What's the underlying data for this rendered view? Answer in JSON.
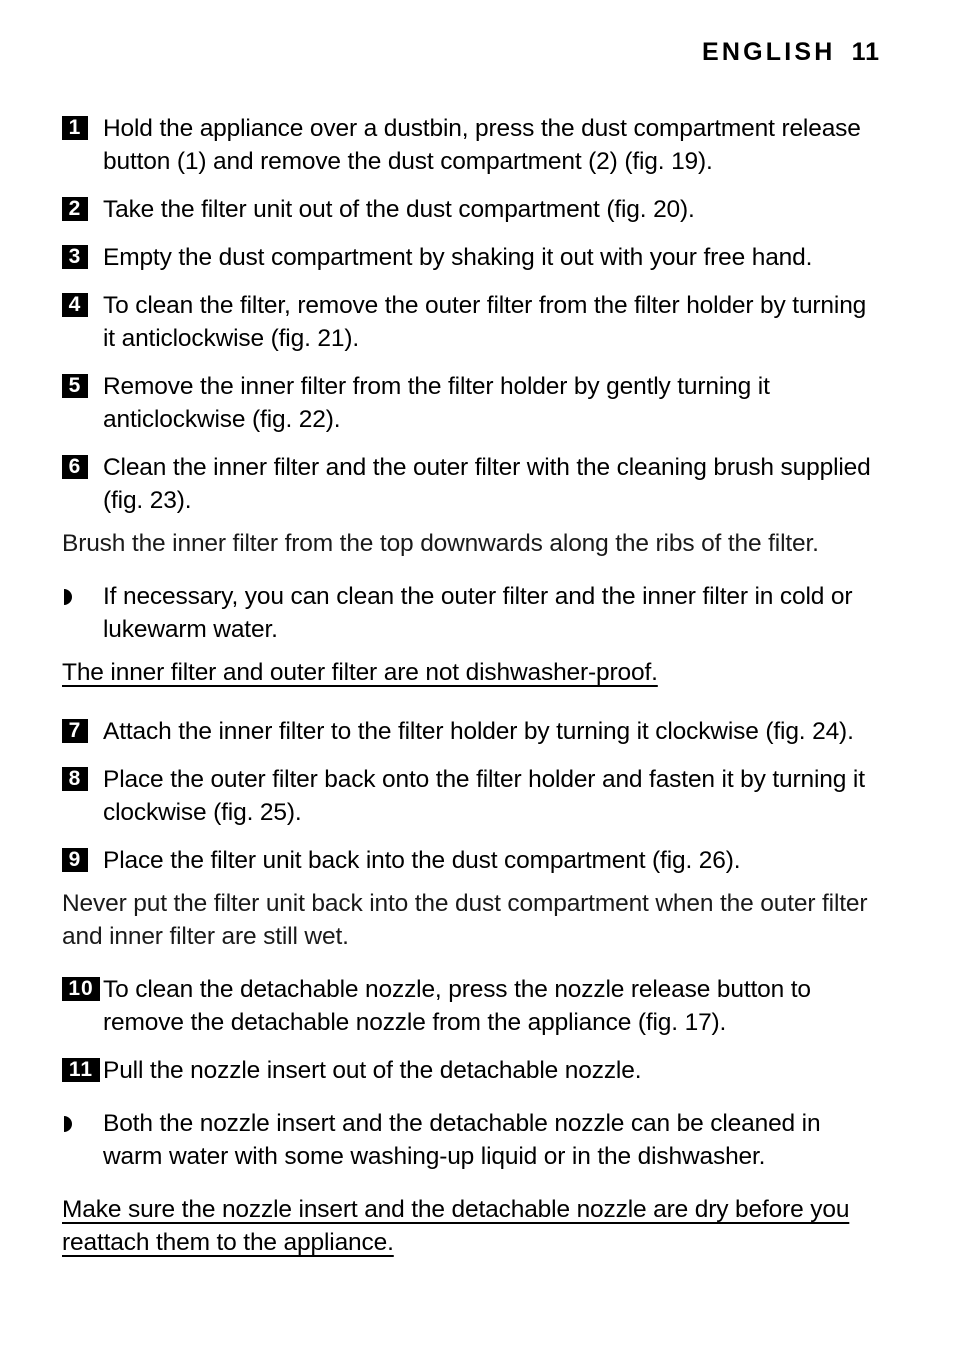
{
  "header": {
    "title": "ENGLISH",
    "page_number": "11"
  },
  "body": {
    "blocks": [
      {
        "kind": "step",
        "number": "1",
        "text": "Hold the appliance over a dustbin, press the dust compartment release button (1) and remove the dust compartment (2) (fig. 19)."
      },
      {
        "kind": "step",
        "number": "2",
        "text": "Take the filter unit out of the dust compartment (fig. 20)."
      },
      {
        "kind": "step",
        "number": "3",
        "text": "Empty the dust compartment by shaking it out with your free hand."
      },
      {
        "kind": "step",
        "number": "4",
        "text": "To clean the filter, remove the outer filter from the filter holder by turning it anticlockwise (fig. 21)."
      },
      {
        "kind": "step",
        "number": "5",
        "text": "Remove the inner filter from the filter holder by gently turning it anticlockwise (fig. 22)."
      },
      {
        "kind": "step",
        "number": "6",
        "text": "Clean the inner filter and the outer filter with the cleaning brush supplied (fig. 23)."
      },
      {
        "kind": "paragraph",
        "style": "light",
        "text": "Brush the inner filter from the top downwards along the ribs of the filter."
      },
      {
        "kind": "bullet",
        "text": "If necessary, you can clean the outer filter and the inner filter in cold or lukewarm water."
      },
      {
        "kind": "paragraph",
        "style": "underlined",
        "text": "The inner filter and outer filter are not dishwasher-proof."
      },
      {
        "kind": "step",
        "number": "7",
        "text": "Attach the inner filter to the filter holder by turning it clockwise (fig. 24)."
      },
      {
        "kind": "step",
        "number": "8",
        "text": "Place the outer filter back onto the filter holder and fasten it by turning it clockwise (fig. 25)."
      },
      {
        "kind": "step",
        "number": "9",
        "text": "Place the filter unit back into the dust compartment (fig. 26)."
      },
      {
        "kind": "paragraph",
        "style": "light",
        "text": "Never put the filter unit back into the dust compartment when the outer filter and inner filter are still wet."
      },
      {
        "kind": "step",
        "number": "10",
        "text": "To clean the detachable nozzle, press the nozzle release button to remove the detachable nozzle from the appliance (fig. 17)."
      },
      {
        "kind": "step",
        "number": "11",
        "text": "Pull the nozzle insert out of the detachable nozzle."
      },
      {
        "kind": "bullet",
        "text": "Both the nozzle insert and the detachable nozzle can be cleaned in warm water with some washing-up liquid or in the dishwasher."
      },
      {
        "kind": "paragraph",
        "style": "underlined",
        "text": "Make sure the nozzle insert and the detachable nozzle are dry before you reattach them to the appliance."
      }
    ]
  }
}
